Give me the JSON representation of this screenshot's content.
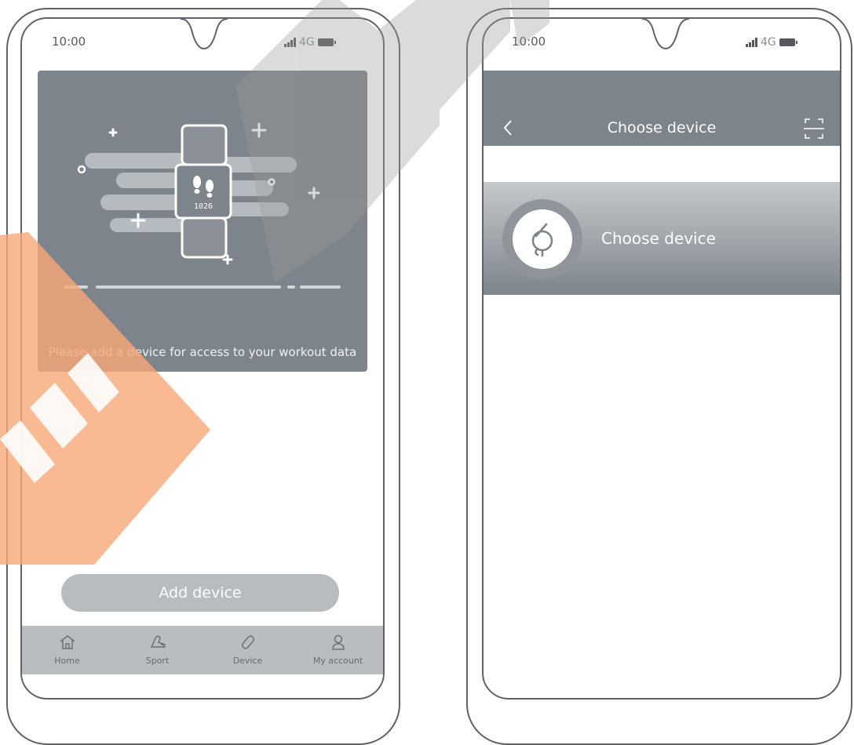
{
  "left_phone": {
    "status": {
      "time": "10:00",
      "network": "4G"
    },
    "hero": {
      "message": "Please add a device for access to your workout data",
      "step_count": "1026"
    },
    "add_device_label": "Add device",
    "tabs": [
      {
        "icon": "home-icon",
        "label": "Home"
      },
      {
        "icon": "sport-icon",
        "label": "Sport"
      },
      {
        "icon": "device-icon",
        "label": "Device"
      },
      {
        "icon": "person-icon",
        "label": "My account"
      }
    ]
  },
  "right_phone": {
    "status": {
      "time": "10:00",
      "network": "4G"
    },
    "nav": {
      "title": "Choose device"
    },
    "device_row": {
      "label": "Choose device"
    }
  },
  "colors": {
    "header_gray": "#7d848b",
    "button_gray": "#b8bcc0",
    "tabbar_gray": "#b9bdc1",
    "watermark_orange": "#f7a877",
    "watermark_gray": "#9a9a9a"
  }
}
